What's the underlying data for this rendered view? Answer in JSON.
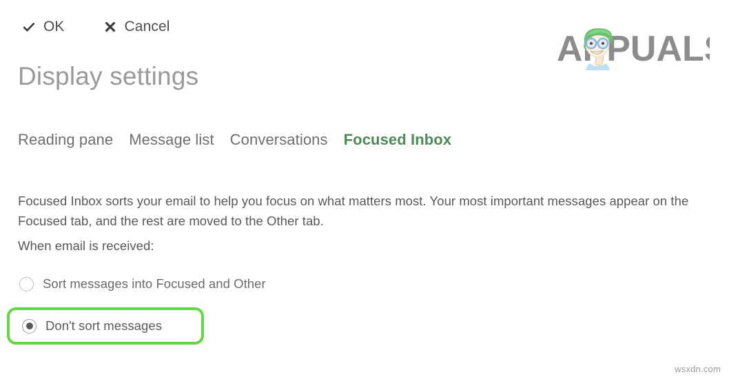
{
  "window": {
    "background_color": "#ffffff"
  },
  "command_bar": {
    "buttons": [
      {
        "id": "ok",
        "label": "OK",
        "icon": "checkmark-icon",
        "glyph": "✔"
      },
      {
        "id": "cancel",
        "label": "Cancel",
        "icon": "close-x-icon",
        "glyph": "✖"
      }
    ]
  },
  "header": {
    "title": "Display settings"
  },
  "tabs": [
    {
      "label": "Reading pane",
      "selected": false
    },
    {
      "label": "Message list",
      "selected": false
    },
    {
      "label": "Conversations",
      "selected": false
    },
    {
      "label": "Focused Inbox",
      "selected": true
    }
  ],
  "main": {
    "description": "Focused Inbox sorts your email to help you focus on what matters most. Your most important messages appear on the Focused tab, and the rest are moved to the Other tab.",
    "group_label": "When email is received:",
    "options": [
      {
        "label": "Sort messages into Focused and Other",
        "checked": false,
        "highlighted": false
      },
      {
        "label": "Don't sort messages",
        "checked": true,
        "highlighted": true
      }
    ]
  },
  "annotation": {
    "highlight_color": "#63d646",
    "shape": "rounded-rectangle"
  },
  "branding": {
    "logo_text": "APPUALS",
    "logo_text_color": "#8c8c8c",
    "hair_color": "#6cc072",
    "skin_color": "#f6e7d3",
    "glasses_color": "#8ab6dd",
    "watermark": "wsxdn.com"
  },
  "colors": {
    "title": "#999999",
    "body_text": "#585858",
    "tab_inactive": "#6e6e6e",
    "tab_active": "#4c8a55",
    "accent_green": "#63d646"
  }
}
